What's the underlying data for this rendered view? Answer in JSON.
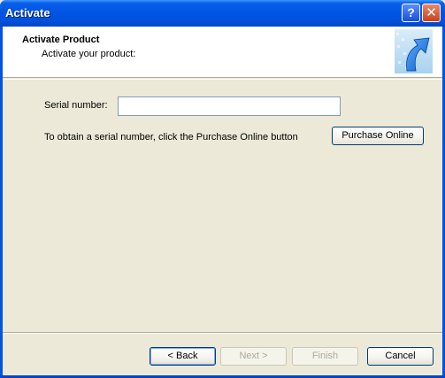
{
  "window": {
    "title": "Activate",
    "help_icon": "question-mark-icon",
    "help_label": "?",
    "close_icon": "close-x-icon",
    "close_label": "✕",
    "accent_color": "#0054e3"
  },
  "header": {
    "title": "Activate Product",
    "subtitle": "Activate your product:",
    "graphic_icon": "activation-arrow-icon"
  },
  "form": {
    "serial_label": "Serial number:",
    "serial_value": "",
    "serial_placeholder": "",
    "obtain_text": "To obtain a serial number, click the Purchase Online button",
    "purchase_button": "Purchase Online"
  },
  "footer": {
    "back_button": "< Back",
    "next_button": "Next >",
    "finish_button": "Finish",
    "cancel_button": "Cancel"
  }
}
